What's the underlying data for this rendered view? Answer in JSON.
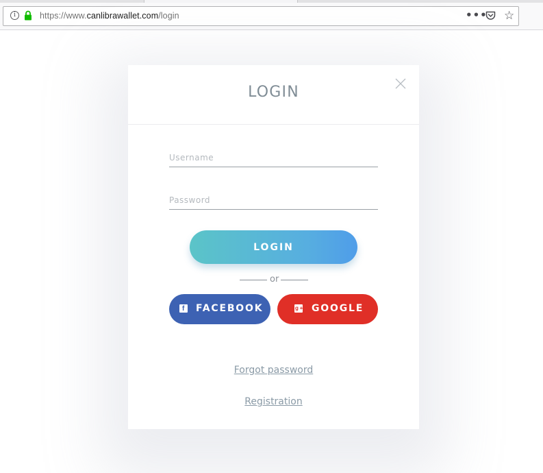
{
  "browser": {
    "url_prefix": "https://www.",
    "url_domain": "canlibrawallet.com",
    "url_path": "/login",
    "icons": [
      "info-icon",
      "lock-icon",
      "more-dots-icon",
      "pocket-icon",
      "bookmark-star-icon"
    ]
  },
  "modal": {
    "title": "LOGIN",
    "username_placeholder": "Username",
    "password_placeholder": "Password",
    "login_label": "LOGIN",
    "or_text": "or",
    "facebook_label": "FACEBOOK",
    "google_label": "GOOGLE",
    "forgot_label": "Forgot password",
    "registration_label": "Registration"
  },
  "colors": {
    "facebook": "#3d62b3",
    "google": "#e02f27",
    "login_gradient_start": "#5bc4c8",
    "login_gradient_end": "#4f9de9",
    "lock_green": "#12bc00"
  }
}
